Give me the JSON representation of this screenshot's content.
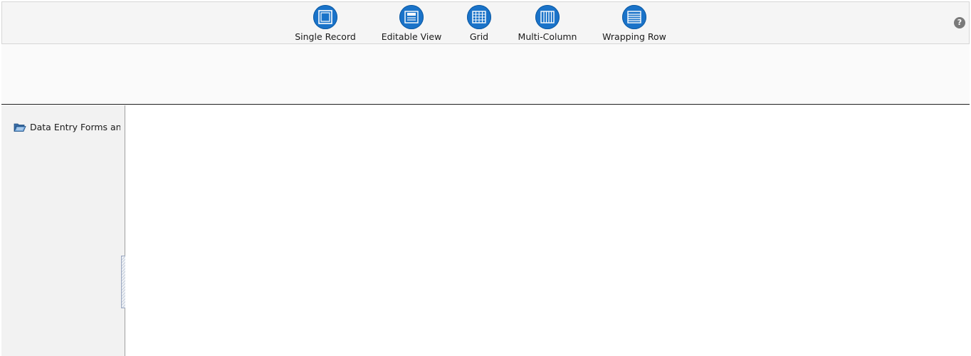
{
  "toolbar": {
    "buttons": [
      {
        "label": "Single Record",
        "icon": "single-record-icon"
      },
      {
        "label": "Editable View",
        "icon": "editable-view-icon"
      },
      {
        "label": "Grid",
        "icon": "grid-icon"
      },
      {
        "label": "Multi-Column",
        "icon": "multi-column-icon"
      },
      {
        "label": "Wrapping Row",
        "icon": "wrapping-row-icon"
      }
    ],
    "help": {
      "label": "?",
      "icon": "help-icon"
    }
  },
  "sidebar": {
    "items": [
      {
        "label": "Data Entry Forms and",
        "icon": "open-folder-icon"
      }
    ]
  },
  "colors": {
    "accent": "#1a73c9",
    "toolbar_bg": "#f5f5f5",
    "sidebar_bg": "#f2f2f2"
  }
}
